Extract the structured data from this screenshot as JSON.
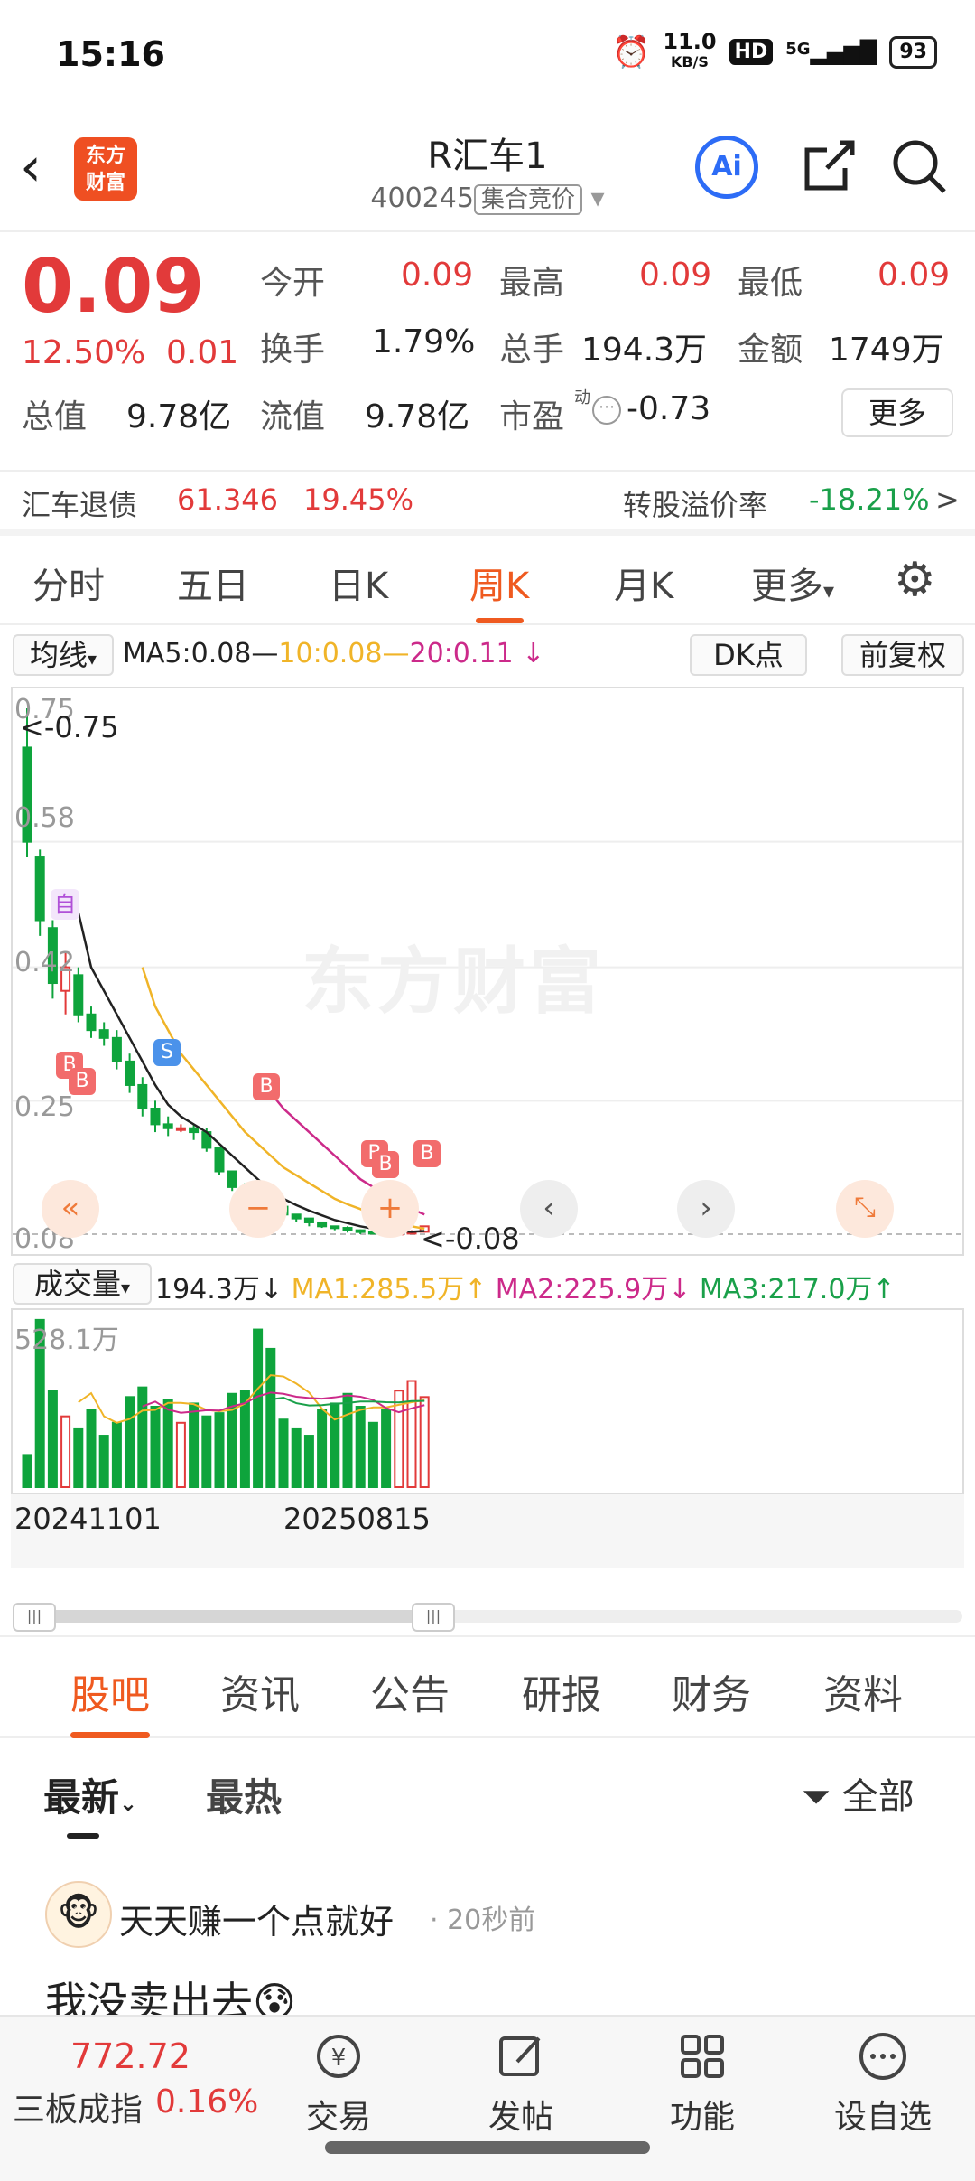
{
  "status": {
    "time": "15:16",
    "net_speed": "11.0",
    "net_unit": "KB/S",
    "hd": "HD",
    "network": "5G",
    "battery": "93"
  },
  "header": {
    "logo_line1": "东方",
    "logo_line2": "财富",
    "title": "R汇车1",
    "code": "400245",
    "tag": "集合竞价",
    "ai": "Ai"
  },
  "quote": {
    "price": "0.09",
    "change_pct": "12.50%",
    "change": "0.01",
    "labels": {
      "open": "今开",
      "high": "最高",
      "low": "最低",
      "turnover": "换手",
      "volume": "总手",
      "amount": "金额",
      "mcap": "总值",
      "float_mcap": "流值",
      "pe": "市盈"
    },
    "values": {
      "open": "0.09",
      "high": "0.09",
      "low": "0.09",
      "turnover": "1.79%",
      "volume": "194.3万",
      "amount": "1749万",
      "mcap": "9.78亿",
      "float_mcap": "9.78亿",
      "pe": "-0.73"
    },
    "pe_sup": "动",
    "more": "更多"
  },
  "bond": {
    "name": "汇车退债",
    "price": "61.346",
    "pct": "19.45%",
    "premium_label": "转股溢价率",
    "premium": "-18.21%",
    "arrow": ">"
  },
  "period_tabs": [
    "分时",
    "五日",
    "日K",
    "周K",
    "月K",
    "更多"
  ],
  "period_active": 3,
  "chart": {
    "ma_selector": "均线",
    "ma5": "MA5:0.08",
    "ma10": "10:0.08",
    "ma20": "20:0.11",
    "dk_btn": "DK点",
    "fq_btn": "前复权",
    "ytick_top": "0.75",
    "ytick_2": "0.58",
    "ytick_3": "0.42",
    "ytick_4": "0.25",
    "ytick_bottom": "0.08",
    "high_marker": "<-0.75",
    "low_marker": "<-0.08",
    "watermark": "东方财富",
    "marker_zi": "自",
    "marker_b": "B",
    "marker_s": "S",
    "vol_selector": "成交量",
    "vol_value": "194.3万",
    "vol_ma1": "MA1:285.5万",
    "vol_ma2": "MA2:225.9万",
    "vol_ma3": "MA3:217.0万",
    "vol_max": "528.1万",
    "date_left": "20241101",
    "date_right": "20250815",
    "colors": {
      "up": "#e23a3a",
      "down": "#0ea43c",
      "ma5": "#222222",
      "ma10": "#f0b428",
      "ma20": "#cc2a8a",
      "vma3": "#1aa04a"
    }
  },
  "chart_data": {
    "type": "candlestick",
    "title": "周K",
    "ylim": [
      0.08,
      0.75
    ],
    "candles": [
      {
        "o": 0.7,
        "c": 0.58,
        "h": 0.75,
        "l": 0.56
      },
      {
        "o": 0.56,
        "c": 0.48,
        "h": 0.57,
        "l": 0.46
      },
      {
        "o": 0.47,
        "c": 0.4,
        "h": 0.48,
        "l": 0.38
      },
      {
        "o": 0.39,
        "c": 0.42,
        "h": 0.44,
        "l": 0.36
      },
      {
        "o": 0.41,
        "c": 0.36,
        "h": 0.42,
        "l": 0.35
      },
      {
        "o": 0.36,
        "c": 0.34,
        "h": 0.37,
        "l": 0.33
      },
      {
        "o": 0.34,
        "c": 0.33,
        "h": 0.35,
        "l": 0.32
      },
      {
        "o": 0.33,
        "c": 0.3,
        "h": 0.34,
        "l": 0.29
      },
      {
        "o": 0.3,
        "c": 0.27,
        "h": 0.31,
        "l": 0.26
      },
      {
        "o": 0.27,
        "c": 0.24,
        "h": 0.28,
        "l": 0.23
      },
      {
        "o": 0.24,
        "c": 0.22,
        "h": 0.25,
        "l": 0.21
      },
      {
        "o": 0.22,
        "c": 0.215,
        "h": 0.23,
        "l": 0.205
      },
      {
        "o": 0.215,
        "c": 0.215,
        "h": 0.22,
        "l": 0.21
      },
      {
        "o": 0.215,
        "c": 0.21,
        "h": 0.22,
        "l": 0.2
      },
      {
        "o": 0.21,
        "c": 0.19,
        "h": 0.215,
        "l": 0.185
      },
      {
        "o": 0.19,
        "c": 0.16,
        "h": 0.19,
        "l": 0.155
      },
      {
        "o": 0.16,
        "c": 0.14,
        "h": 0.16,
        "l": 0.135
      },
      {
        "o": 0.14,
        "c": 0.13,
        "h": 0.145,
        "l": 0.125
      },
      {
        "o": 0.13,
        "c": 0.12,
        "h": 0.13,
        "l": 0.115
      },
      {
        "o": 0.12,
        "c": 0.115,
        "h": 0.12,
        "l": 0.11
      },
      {
        "o": 0.115,
        "c": 0.105,
        "h": 0.115,
        "l": 0.1
      },
      {
        "o": 0.105,
        "c": 0.1,
        "h": 0.105,
        "l": 0.095
      },
      {
        "o": 0.1,
        "c": 0.095,
        "h": 0.1,
        "l": 0.09
      },
      {
        "o": 0.095,
        "c": 0.09,
        "h": 0.095,
        "l": 0.088
      },
      {
        "o": 0.09,
        "c": 0.088,
        "h": 0.09,
        "l": 0.085
      },
      {
        "o": 0.088,
        "c": 0.085,
        "h": 0.09,
        "l": 0.082
      },
      {
        "o": 0.085,
        "c": 0.083,
        "h": 0.086,
        "l": 0.08
      },
      {
        "o": 0.083,
        "c": 0.082,
        "h": 0.084,
        "l": 0.08
      },
      {
        "o": 0.082,
        "c": 0.081,
        "h": 0.083,
        "l": 0.08
      },
      {
        "o": 0.081,
        "c": 0.082,
        "h": 0.083,
        "l": 0.08
      },
      {
        "o": 0.082,
        "c": 0.083,
        "h": 0.085,
        "l": 0.08
      },
      {
        "o": 0.083,
        "c": 0.09,
        "h": 0.09,
        "l": 0.082
      }
    ],
    "ma5": [
      null,
      null,
      null,
      null,
      0.49,
      0.42,
      0.39,
      0.36,
      0.33,
      0.3,
      0.27,
      0.245,
      0.23,
      0.22,
      0.21,
      0.195,
      0.18,
      0.165,
      0.15,
      0.135,
      0.125,
      0.117,
      0.11,
      0.104,
      0.098,
      0.094,
      0.09,
      0.087,
      0.085,
      0.084,
      0.083,
      0.084
    ],
    "ma10": [
      null,
      null,
      null,
      null,
      null,
      null,
      null,
      null,
      null,
      0.42,
      0.37,
      0.34,
      0.31,
      0.29,
      0.27,
      0.25,
      0.23,
      0.21,
      0.195,
      0.18,
      0.165,
      0.155,
      0.145,
      0.135,
      0.125,
      0.118,
      0.112,
      0.105,
      0.1,
      0.095,
      0.09,
      0.087
    ],
    "ma20": [
      null,
      null,
      null,
      null,
      null,
      null,
      null,
      null,
      null,
      null,
      null,
      null,
      null,
      null,
      null,
      null,
      null,
      null,
      null,
      0.26,
      0.24,
      0.225,
      0.21,
      0.195,
      0.18,
      0.165,
      0.15,
      0.14,
      0.13,
      0.12,
      0.112,
      0.105
    ],
    "volume": [
      100,
      520,
      300,
      220,
      180,
      240,
      160,
      200,
      280,
      310,
      250,
      270,
      200,
      260,
      220,
      230,
      290,
      300,
      490,
      430,
      210,
      180,
      160,
      240,
      260,
      290,
      250,
      200,
      240,
      300,
      330,
      280
    ],
    "vol_ylim": [
      0,
      528.1
    ],
    "x_labels": [
      "20241101",
      "20250815"
    ]
  },
  "section_tabs": [
    "股吧",
    "资讯",
    "公告",
    "研报",
    "财务",
    "资料"
  ],
  "section_active": 0,
  "feed": {
    "sort_new": "最新",
    "sort_hot": "最热",
    "filter": "全部",
    "post": {
      "user": "天天赚一个点就好",
      "time": "· 20秒前",
      "text": "我没卖出去"
    }
  },
  "bottom": {
    "index_value": "772.72",
    "index_name": "三板成指",
    "index_pct": "0.16%",
    "trade": "交易",
    "post": "发帖",
    "func": "功能",
    "watch": "设自选"
  }
}
